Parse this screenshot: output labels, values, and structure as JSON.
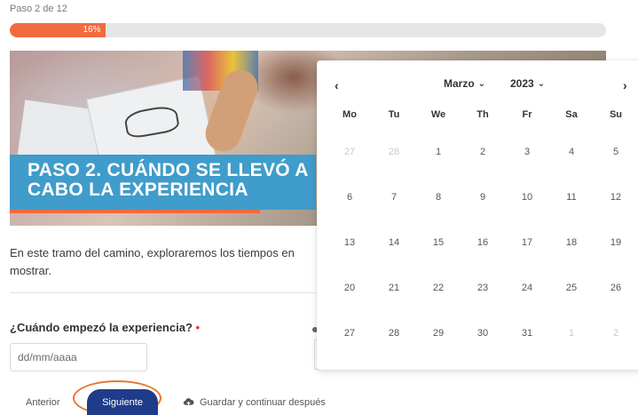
{
  "wizard": {
    "step_label": "Paso 2 de 12",
    "progress_percent": 16,
    "progress_text": "16%"
  },
  "banner": {
    "line1": "PASO 2. CUÁNDO SE LLEVÓ A",
    "line2": "CABO LA EXPERIENCIA"
  },
  "intro": {
    "text": "En este tramo del camino, exploraremos los tiempos en",
    "text2": "mostrar."
  },
  "question": {
    "label": "¿Cuándo empezó la experiencia?",
    "required_mark": "•",
    "input_placeholder": "dd/mm/aaaa"
  },
  "actions": {
    "previous": "Anterior",
    "next": "Siguiente",
    "save_later": "Guardar y continuar después"
  },
  "datepicker": {
    "prev_icon": "‹",
    "next_icon": "›",
    "month": "Marzo",
    "year": "2023",
    "weekdays": [
      "Mo",
      "Tu",
      "We",
      "Th",
      "Fr",
      "Sa",
      "Su"
    ],
    "weeks": [
      [
        {
          "d": "27",
          "out": true
        },
        {
          "d": "28",
          "out": true
        },
        {
          "d": "1"
        },
        {
          "d": "2"
        },
        {
          "d": "3"
        },
        {
          "d": "4"
        },
        {
          "d": "5"
        }
      ],
      [
        {
          "d": "6"
        },
        {
          "d": "7"
        },
        {
          "d": "8"
        },
        {
          "d": "9"
        },
        {
          "d": "10"
        },
        {
          "d": "11"
        },
        {
          "d": "12"
        }
      ],
      [
        {
          "d": "13"
        },
        {
          "d": "14"
        },
        {
          "d": "15"
        },
        {
          "d": "16"
        },
        {
          "d": "17"
        },
        {
          "d": "18"
        },
        {
          "d": "19"
        }
      ],
      [
        {
          "d": "20"
        },
        {
          "d": "21"
        },
        {
          "d": "22"
        },
        {
          "d": "23"
        },
        {
          "d": "24"
        },
        {
          "d": "25"
        },
        {
          "d": "26"
        }
      ],
      [
        {
          "d": "27"
        },
        {
          "d": "28"
        },
        {
          "d": "29"
        },
        {
          "d": "30"
        },
        {
          "d": "31"
        },
        {
          "d": "1",
          "out": true
        },
        {
          "d": "2",
          "out": true
        }
      ]
    ]
  },
  "colors": {
    "accent_orange": "#f26a3e",
    "banner_blue": "#3f9ccb",
    "primary_button": "#1f3b8a"
  }
}
